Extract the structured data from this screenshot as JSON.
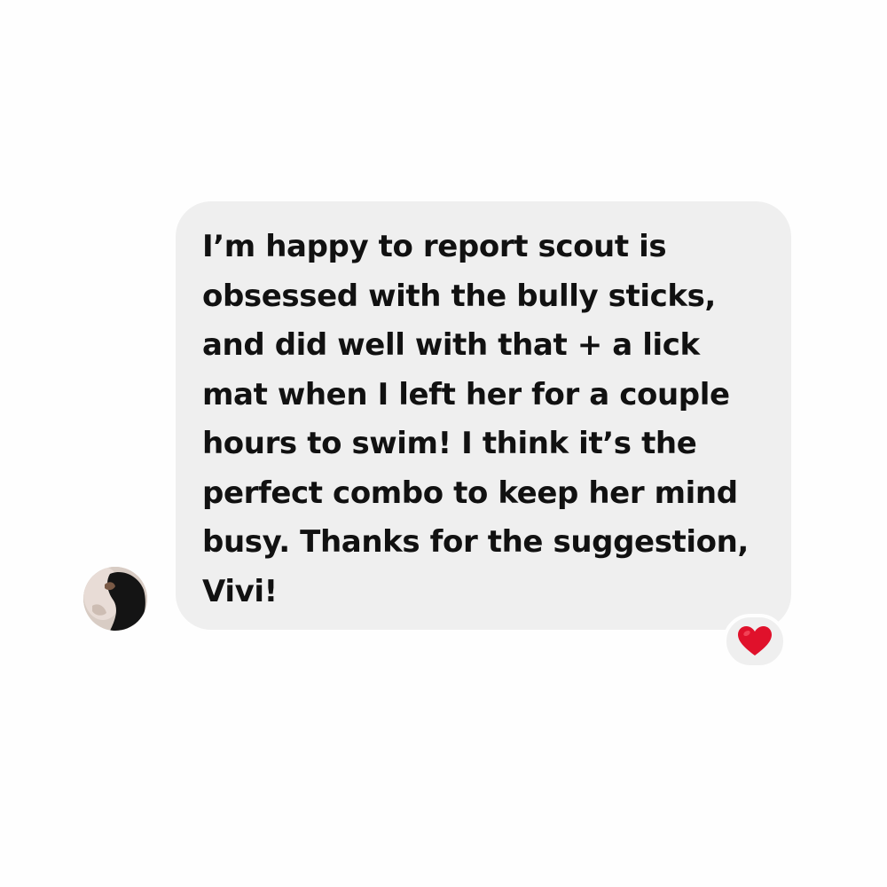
{
  "message": {
    "text": "I’m happy to report scout is\nobsessed with the bully sticks,\nand did well with that + a lick\nmat when I left her for a couple\nhours to swim! I think it’s the\nperfect combo to keep her mind\nbusy. Thanks for the suggestion,\nVivi!",
    "reaction_icon": "heart-icon",
    "avatar_icon": "sender-avatar"
  },
  "colors": {
    "bubble": "#efefef",
    "background": "#fefefe",
    "text": "#111111",
    "heart": "#e0112b"
  }
}
